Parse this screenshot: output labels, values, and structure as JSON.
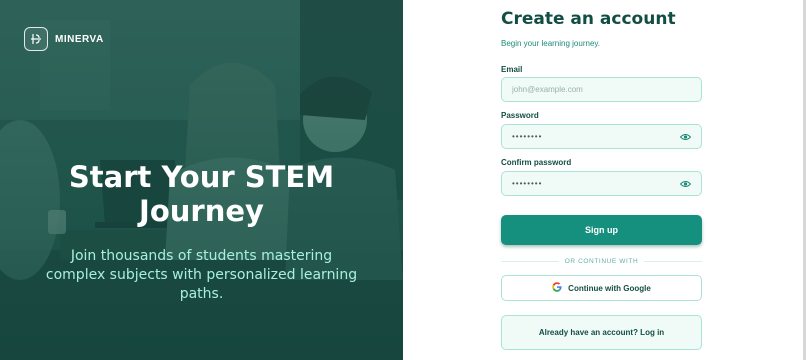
{
  "brand": {
    "name": "MINERVA",
    "logo_icon": "abacus-icon"
  },
  "hero": {
    "title": "Start Your STEM Journey",
    "subtitle": "Join thousands of students mastering complex subjects with personalized learning paths.",
    "image_description": "",
    "colors": {
      "overlay": "#175046",
      "subtitle": "#a8f0dc"
    }
  },
  "form": {
    "title": "Create an account",
    "subtitle": "Begin your learning journey.",
    "email": {
      "label": "Email",
      "placeholder": "john@example.com",
      "value": ""
    },
    "password": {
      "label": "Password",
      "value": "••••••••",
      "toggle_icon": "eye-icon"
    },
    "confirm_password": {
      "label": "Confirm password",
      "value": "••••••••",
      "toggle_icon": "eye-icon"
    },
    "signup_label": "Sign up",
    "divider_label": "OR CONTINUE WITH",
    "google_label": "Continue with Google",
    "login_prompt": "Already have an account? Log in"
  },
  "colors": {
    "accent": "#15907e",
    "heading": "#134e44",
    "field_bg": "#f0fbf8",
    "field_border": "#a9e3d8"
  }
}
